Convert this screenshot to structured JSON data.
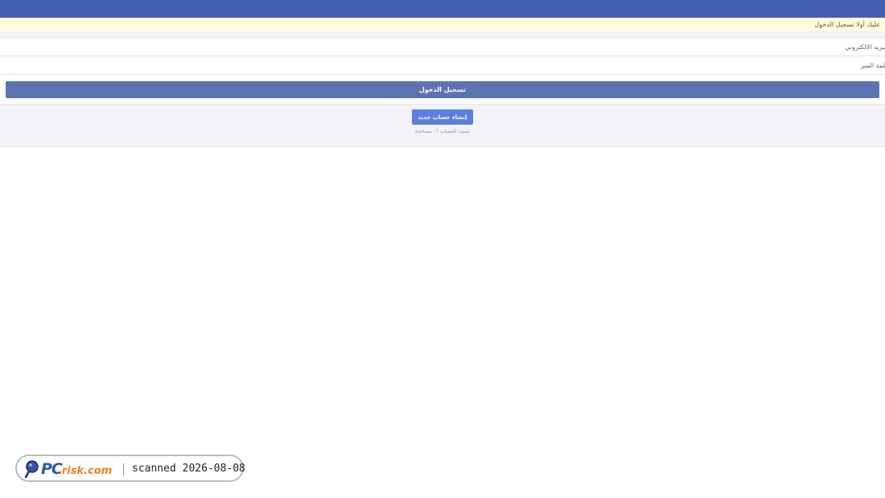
{
  "notice": {
    "text": "عليك أولا تسجيل الدخول"
  },
  "login_form": {
    "email_placeholder": "البريد الالكتروني",
    "password_placeholder": "كلمة السر",
    "login_label": "تسجيل الدخول"
  },
  "footer_actions": {
    "create_account_label": "إنشاء حساب جديد",
    "forgot_account_label": "نسيت الحساب ؟",
    "help_label": "مساعدة",
    "separator": "·"
  },
  "watermark": {
    "logo_text": "PCrisk.com",
    "scanned_label": "scanned 2026-08-08"
  },
  "colors": {
    "topbar": "#4460b0",
    "login_button": "#5b74b0",
    "create_button": "#5b7ee3",
    "notice_bg": "#fffbe0"
  }
}
